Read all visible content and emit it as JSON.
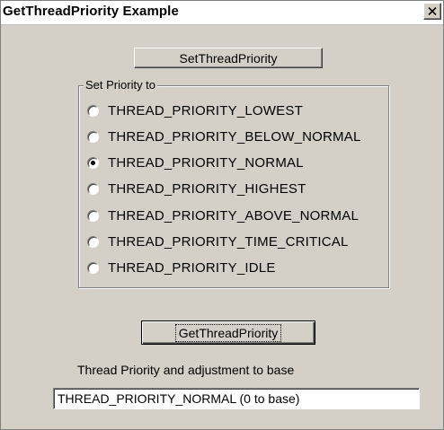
{
  "window": {
    "title": "GetThreadPriority Example",
    "close_label": "X"
  },
  "buttons": {
    "set_priority": "SetThreadPriority",
    "get_priority": "GetThreadPriority"
  },
  "group": {
    "label": "Set Priority to",
    "selected_index": 2,
    "options": [
      "THREAD_PRIORITY_LOWEST",
      "THREAD_PRIORITY_BELOW_NORMAL",
      "THREAD_PRIORITY_NORMAL",
      "THREAD_PRIORITY_HIGHEST",
      "THREAD_PRIORITY_ABOVE_NORMAL",
      "THREAD_PRIORITY_TIME_CRITICAL",
      "THREAD_PRIORITY_IDLE"
    ]
  },
  "result": {
    "label": "Thread Priority and adjustment to base",
    "value": "THREAD_PRIORITY_NORMAL (0 to base)"
  }
}
